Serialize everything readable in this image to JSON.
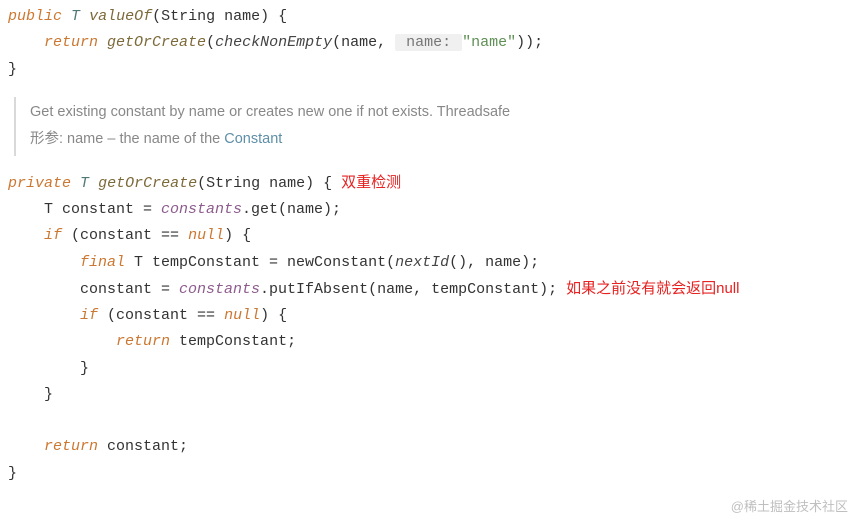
{
  "block1": {
    "kw_public": "public",
    "type_T": "T",
    "fn_valueOf": "valueOf",
    "sig_open": "(String name) {",
    "kw_return": "return",
    "fn_getOrCreate": "getOrCreate",
    "paren_open": "(",
    "fn_checkNonEmpty": "checkNonEmpty",
    "args_open": "(name, ",
    "hint": " name: ",
    "str_name": "\"name\"",
    "args_close": "));",
    "brace_close": "}"
  },
  "doc": {
    "line1": "Get existing constant by name or creates new one if not exists. Threadsafe",
    "line2_pre": "形参: name – the name of the ",
    "line2_link": "Constant"
  },
  "block2": {
    "kw_private": "private",
    "type_T": "T",
    "fn_getOrCreate": "getOrCreate",
    "sig": "(String name) {",
    "anno1": "双重检测",
    "l2_a": "    T constant = ",
    "l2_field": "constants",
    "l2_b": ".get(name);",
    "l3_a": "    ",
    "kw_if": "if",
    "l3_b": " (constant == ",
    "kw_null": "null",
    "l3_c": ") {",
    "l4_a": "        ",
    "kw_final": "final",
    "l4_b": " T tempConstant = newConstant(",
    "fn_nextId": "nextId",
    "l4_c": "(), name);",
    "l5_a": "        constant = ",
    "l5_field": "constants",
    "l5_b": ".putIfAbsent(name, tempConstant);",
    "anno2": "如果之前没有就会返回null",
    "l6_a": "        ",
    "l6_b": " (constant == ",
    "l6_c": ") {",
    "l7_a": "            ",
    "kw_return": "return",
    "l7_b": " tempConstant;",
    "l8": "        }",
    "l9": "    }",
    "blank": "",
    "l10_a": "    ",
    "l10_b": " constant;",
    "l11": "}"
  },
  "watermark": "@稀土掘金技术社区"
}
